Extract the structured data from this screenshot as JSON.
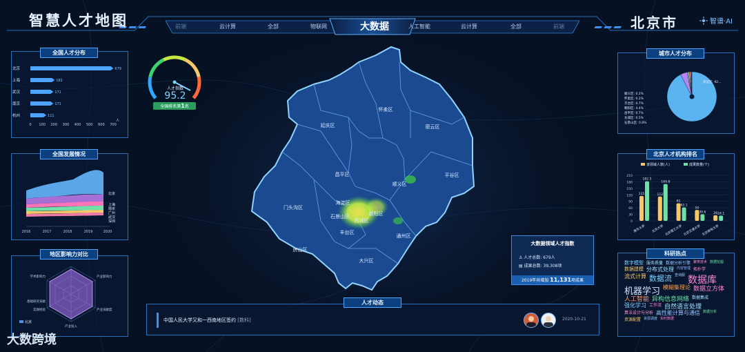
{
  "header": {
    "title_left": "智慧人才地图",
    "title_right": "北京市",
    "brand": "智谱·AI",
    "nav_left": [
      "前端",
      "云计算",
      "全部",
      "物联网"
    ],
    "nav_center": "大数据",
    "nav_right": [
      "人工智能",
      "云计算",
      "全部",
      "前端"
    ]
  },
  "panels": {
    "national_dist": {
      "title": "全国人才分布",
      "cities": [
        "北京",
        "上海",
        "武汉",
        "南京",
        "杭州"
      ],
      "values": [
        679,
        182,
        171,
        171,
        111
      ],
      "ticks": [
        "0",
        "100",
        "200",
        "300",
        "400",
        "500",
        "600",
        "700"
      ],
      "unit": "人"
    },
    "gauge": {
      "label": "人才指数",
      "value": "95.2",
      "badge_pre": "全国排名第",
      "badge_num": "1",
      "badge_post": "名"
    },
    "national_dev": {
      "title": "全国发展情况",
      "years": [
        "2016",
        "2017",
        "2018",
        "2019",
        "2020"
      ],
      "legend": [
        "北京",
        "上海",
        "南京",
        "广州",
        "武汉",
        "深圳"
      ]
    },
    "region_compare": {
      "title": "地区影响力对比",
      "axes": [
        "学术影响力",
        "产业影响力",
        "产业贡献度",
        "产业投入",
        "实践经验",
        "基础研究贡献"
      ],
      "legend": "北京"
    },
    "city_dist": {
      "title": "城市人才分布",
      "labels_left": [
        "顺义区: 0.2%",
        "怀柔区: 0.2%",
        "丰台区: 0.7%",
        "朝阳区: 4.4%",
        "昌平区: 0.7%",
        "东城区: 0.5%",
        "石景山区: 0.8%"
      ],
      "label_right": "海淀区: 92...",
      "chart_data": {
        "type": "pie",
        "labels": [
          "海淀区",
          "朝阳区",
          "石景山区",
          "丰台区",
          "昌平区",
          "东城区",
          "顺义区",
          "怀柔区"
        ],
        "values": [
          92.5,
          4.4,
          0.8,
          0.7,
          0.7,
          0.5,
          0.2,
          0.2
        ],
        "colors": [
          "#5ab4ef",
          "#b784f5",
          "#6fe0a8",
          "#f0c85a",
          "#f48a8a",
          "#8fb8ff",
          "#9be0ff",
          "#ff9ad1"
        ]
      }
    },
    "institution_rank": {
      "title": "北京人才机构排名",
      "legend_a": "该领域人数(人)",
      "legend_b": "成果数量(个)",
      "chart_data": {
        "type": "bar",
        "categories": [
          "清华大学",
          "北京大学",
          "北京理工大学",
          "北京交通大学",
          "北京邮电大学"
        ],
        "series": [
          {
            "name": "该领域人数(人)",
            "values": [
              115,
              112,
              81,
              50,
              26
            ],
            "color": "#f5c76a"
          },
          {
            "name": "成果数量(个)",
            "values": [
              182.5,
              169.8,
              62.1,
              30.6,
              24.1
            ],
            "color": "#6fe0a8"
          }
        ],
        "yticks": [
          "0",
          "30",
          "60",
          "90",
          "120",
          "150",
          "180",
          "210"
        ],
        "ylim": [
          0,
          210
        ]
      }
    },
    "hot_topics": {
      "title": "科研热点",
      "words": [
        {
          "t": "数字模型",
          "c": "#7fd4ff",
          "s": 7
        },
        {
          "t": "服务质量",
          "c": "#a2e2ff",
          "s": 6
        },
        {
          "t": "数据分析引擎",
          "c": "#9bc6ff",
          "s": 6
        },
        {
          "t": "聚类技术",
          "c": "#ff8ad8",
          "s": 5
        },
        {
          "t": "数据挖掘",
          "c": "#6fe0a8",
          "s": 5
        },
        {
          "t": "数据建模",
          "c": "#f5c76a",
          "s": 7
        },
        {
          "t": "分布式处理",
          "c": "#a2e2ff",
          "s": 8
        },
        {
          "t": "内容管理",
          "c": "#8fb8ff",
          "s": 5
        },
        {
          "t": "拓扑学",
          "c": "#ff9ad1",
          "s": 6
        },
        {
          "t": "流式计算",
          "c": "#f5c76a",
          "s": 8
        },
        {
          "t": "数据流",
          "c": "#7fd4ff",
          "s": 11
        },
        {
          "t": "查询服",
          "c": "#9bc6ff",
          "s": 5
        },
        {
          "t": "数据库",
          "c": "#ff8ad8",
          "s": 14
        },
        {
          "t": "机器学习",
          "c": "#d8eaff",
          "s": 13
        },
        {
          "t": "模糊集理论",
          "c": "#f0a05a",
          "s": 8
        },
        {
          "t": "数据立方体",
          "c": "#ff8ad8",
          "s": 9
        },
        {
          "t": "人工智能",
          "c": "#ff9a6a",
          "s": 9
        },
        {
          "t": "异构信息网络",
          "c": "#6fe0a8",
          "s": 9
        },
        {
          "t": "数据集成",
          "c": "#a2e2ff",
          "s": 6
        },
        {
          "t": "强化学习",
          "c": "#7fd4ff",
          "s": 8
        },
        {
          "t": "工作流",
          "c": "#ff8ad8",
          "s": 6
        },
        {
          "t": "自然语言处理",
          "c": "#a2e2ff",
          "s": 9
        },
        {
          "t": "算法设计与分析",
          "c": "#ff9ad1",
          "s": 6
        },
        {
          "t": "高性能计算与通信",
          "c": "#9bc6ff",
          "s": 8
        },
        {
          "t": "数据分析",
          "c": "#6fe0a8",
          "s": 5
        },
        {
          "t": "资源配置",
          "c": "#f5c76a",
          "s": 6
        },
        {
          "t": "资源调度",
          "c": "#9bc6ff",
          "s": 5
        },
        {
          "t": "实时数据",
          "c": "#ff8ad8",
          "s": 5
        }
      ]
    }
  },
  "map": {
    "districts": [
      "延庆区",
      "怀柔区",
      "密云区",
      "昌平区",
      "顺义区",
      "平谷区",
      "门头沟区",
      "海淀区",
      "朝阳区",
      "石景山区",
      "西城区",
      "丰台区",
      "通州区",
      "房山区",
      "大兴区"
    ]
  },
  "info_card": {
    "title": "大数据领域人才指数",
    "row1": "人才总数: 679人",
    "row2": "成果总数: 39,308项",
    "foot_pre": "2019年共增加",
    "foot_num": "11,131",
    "foot_post": "项成果"
  },
  "news": {
    "title": "人才动态",
    "text": "中国人民大学又和一西南地区签约",
    "tag": "[数科]",
    "date": "2020-10-21"
  },
  "watermark": "大数跨境"
}
